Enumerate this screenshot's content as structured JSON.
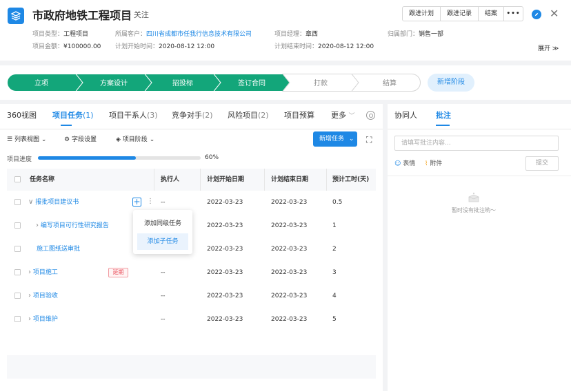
{
  "header": {
    "title": "市政府地铁工程项目",
    "follow_label": "关注",
    "buttons": [
      "跟进计划",
      "跟进记录",
      "结案",
      "•••"
    ],
    "expand_label": "展开",
    "fields": {
      "type_label": "项目类型：",
      "type_value": "工程项目",
      "customer_label": "所属客户：",
      "customer_value": "四川省成都市任我行信息技术有限公司",
      "manager_label": "项目经理：",
      "manager_value": "章西",
      "dept_label": "归属部门：",
      "dept_value": "销售一部",
      "amount_label": "项目金额：",
      "amount_value": "¥100000.00",
      "start_label": "计划开始时间：",
      "start_value": "2020-08-12  12:00",
      "end_label": "计划结束时间：",
      "end_value": "2020-08-12  12:00"
    }
  },
  "stages": {
    "items": [
      {
        "label": "立项",
        "done": true
      },
      {
        "label": "方案设计",
        "done": true
      },
      {
        "label": "招投标",
        "done": true
      },
      {
        "label": "签订合同",
        "done": true
      },
      {
        "label": "打款",
        "done": false
      },
      {
        "label": "结算",
        "done": false
      }
    ],
    "add_label": "新增阶段"
  },
  "tabs": [
    {
      "label": "360视图",
      "count": ""
    },
    {
      "label": "项目任务",
      "count": "(1)"
    },
    {
      "label": "项目干系人",
      "count": "(3)"
    },
    {
      "label": "竞争对手",
      "count": "(2)"
    },
    {
      "label": "风险项目",
      "count": "(2)"
    },
    {
      "label": "项目预算",
      "count": ""
    },
    {
      "label": "更多",
      "count": ""
    }
  ],
  "toolbar": {
    "list_view": "列表视图",
    "field_settings": "字段设置",
    "project_stage": "项目阶段",
    "new_task": "新增任务"
  },
  "progress": {
    "label": "项目进度",
    "value_text": "60%",
    "fraction": 0.6
  },
  "table": {
    "columns": [
      "任务名称",
      "执行人",
      "计划开始日期",
      "计划结束日期",
      "预计工时(天)"
    ],
    "rows": [
      {
        "name": "报批项目建议书",
        "assignee": "--",
        "start": "2022-03-23",
        "end": "2022-03-23",
        "hours": "0.5"
      },
      {
        "name": "编写项目可行性研究报告",
        "assignee": "",
        "start": "2022-03-23",
        "end": "2022-03-23",
        "hours": "1"
      },
      {
        "name": "施工图纸送审批",
        "assignee": "",
        "start": "2022-03-23",
        "end": "2022-03-23",
        "hours": "2"
      },
      {
        "name": "项目施工",
        "assignee": "--",
        "start": "2022-03-23",
        "end": "2022-03-23",
        "hours": "3",
        "tag": "延期"
      },
      {
        "name": "项目验收",
        "assignee": "--",
        "start": "2022-03-23",
        "end": "2022-03-23",
        "hours": "4"
      },
      {
        "name": "项目维护",
        "assignee": "--",
        "start": "2022-03-23",
        "end": "2022-03-23",
        "hours": "5"
      }
    ]
  },
  "popup": {
    "items": [
      "添加同级任务",
      "添加子任务"
    ]
  },
  "side": {
    "tabs": [
      "协同人",
      "批注"
    ],
    "input_placeholder": "请填写批注内容...",
    "emoji_label": "表情",
    "attach_label": "附件",
    "submit_label": "提交",
    "empty_text": "暂时没有批注哟～"
  },
  "colors": {
    "accent": "#1e88e5",
    "stage_done": "#13a67a",
    "delay_tag": "#e94a57"
  },
  "icons": [
    "layers-icon",
    "star-icon",
    "compass-icon",
    "close-icon",
    "chevron-down-icon",
    "list-icon",
    "gear-icon",
    "stage-icon",
    "fullscreen-icon",
    "emoji-icon",
    "paperclip-icon",
    "empty-box-icon"
  ]
}
